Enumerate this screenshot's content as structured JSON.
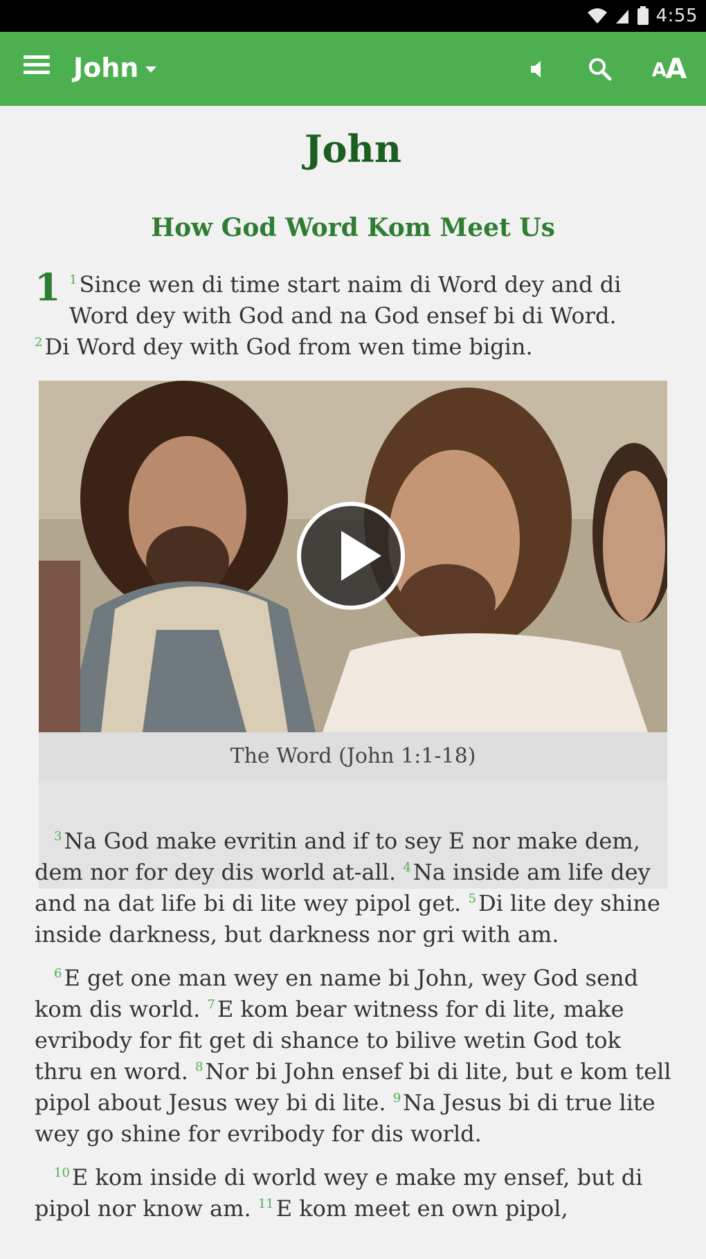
{
  "status_bar": {
    "time": "4:55",
    "icons": [
      "wifi-icon",
      "signal-icon",
      "battery-icon"
    ]
  },
  "app_bar": {
    "menu_icon": "hamburger-menu-icon",
    "book_label": "John",
    "actions": [
      "speaker-icon",
      "search-icon",
      "text-size-icon"
    ],
    "text_size_label_small": "A",
    "text_size_label_large": "A",
    "color": "#4caf50"
  },
  "content": {
    "book_title": "John",
    "section_heading": "How God Word Kom Meet Us",
    "chapter_number": "1",
    "intro_verses": [
      {
        "num": "1",
        "text": "Since wen di time start naim di Word dey and di Word dey with God and na God ensef bi di Word."
      },
      {
        "num": "2",
        "text": "Di Word dey with God from wen time bigin."
      }
    ],
    "video": {
      "caption": "The Word (John 1:1-18)",
      "play_icon": "play-icon"
    },
    "paragraphs": [
      [
        {
          "num": "3",
          "text": "Na God make evritin and if to sey E nor make dem, dem nor for dey dis world at-all."
        },
        {
          "num": "4",
          "text": "Na inside am life dey and na dat life bi di lite wey pipol get."
        },
        {
          "num": "5",
          "text": "Di lite dey shine inside darkness, but darkness nor gri with am."
        }
      ],
      [
        {
          "num": "6",
          "text": "E get one man wey en name bi John, wey God send kom dis world."
        },
        {
          "num": "7",
          "text": "E kom bear witness for di lite, make evribody for fit get di shance to bilive wetin God tok thru en word."
        },
        {
          "num": "8",
          "text": "Nor bi John ensef bi di lite, but e kom tell pipol about Jesus wey bi di lite."
        },
        {
          "num": "9",
          "text": "Na Jesus bi di true lite wey go shine for evribody for dis world."
        }
      ],
      [
        {
          "num": "10",
          "text": "E kom inside di world wey e make my ensef, but di pipol nor know am."
        },
        {
          "num": "11",
          "text": "E kom meet en own pipol,"
        }
      ]
    ]
  }
}
